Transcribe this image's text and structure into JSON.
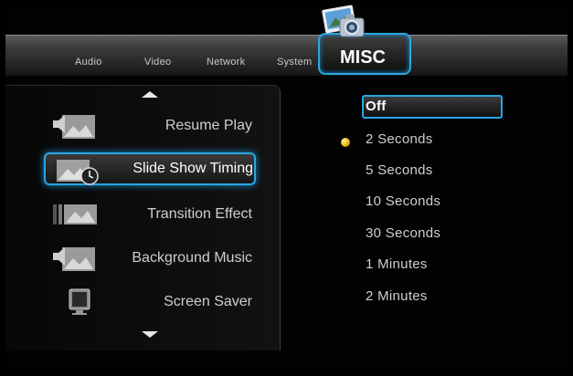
{
  "tabs": [
    {
      "label": "Audio"
    },
    {
      "label": "Video"
    },
    {
      "label": "Network"
    },
    {
      "label": "System"
    }
  ],
  "active_tab": {
    "label": "MISC",
    "icon": "photo-camera-icon"
  },
  "menu": {
    "items": [
      {
        "label": "Resume Play",
        "icon": "photo-speaker-icon"
      },
      {
        "label": "Slide Show Timing",
        "icon": "photo-clock-icon",
        "selected": true
      },
      {
        "label": "Transition Effect",
        "icon": "photo-transition-icon"
      },
      {
        "label": "Background Music",
        "icon": "photo-speaker-icon"
      },
      {
        "label": "Screen Saver",
        "icon": "monitor-icon"
      }
    ]
  },
  "options": {
    "items": [
      "Off",
      "2 Seconds",
      "5 Seconds",
      "10 Seconds",
      "30 Seconds",
      "1 Minutes",
      "2 Minutes"
    ],
    "highlighted": "Off",
    "current": "2 Seconds"
  },
  "colors": {
    "accent": "#2aa6e0",
    "bullet": "#e2b000"
  }
}
